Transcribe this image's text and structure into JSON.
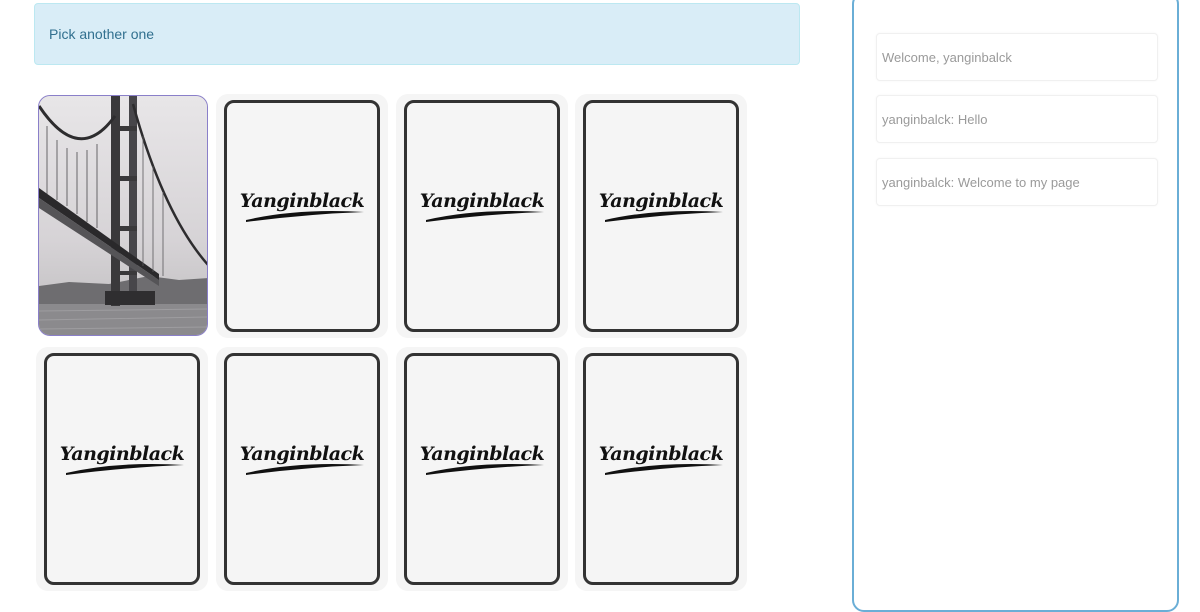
{
  "alert": {
    "text": "Pick another one"
  },
  "cards": [
    {
      "state": "face-up",
      "image": "bridge-photo"
    },
    {
      "state": "face-down",
      "logo": "Yanginblack"
    },
    {
      "state": "face-down",
      "logo": "Yanginblack"
    },
    {
      "state": "face-down",
      "logo": "Yanginblack"
    },
    {
      "state": "face-down",
      "logo": "Yanginblack"
    },
    {
      "state": "face-down",
      "logo": "Yanginblack"
    },
    {
      "state": "face-down",
      "logo": "Yanginblack"
    },
    {
      "state": "face-down",
      "logo": "Yanginblack"
    }
  ],
  "chat": {
    "messages": [
      "Welcome, yanginbalck",
      "yanginbalck: Hello",
      "yanginbalck: Welcome to my page"
    ]
  },
  "colors": {
    "alert_bg": "#d9edf7",
    "alert_text": "#31708f",
    "chat_border": "#6aaed6",
    "face_border": "#8a7fc9"
  }
}
